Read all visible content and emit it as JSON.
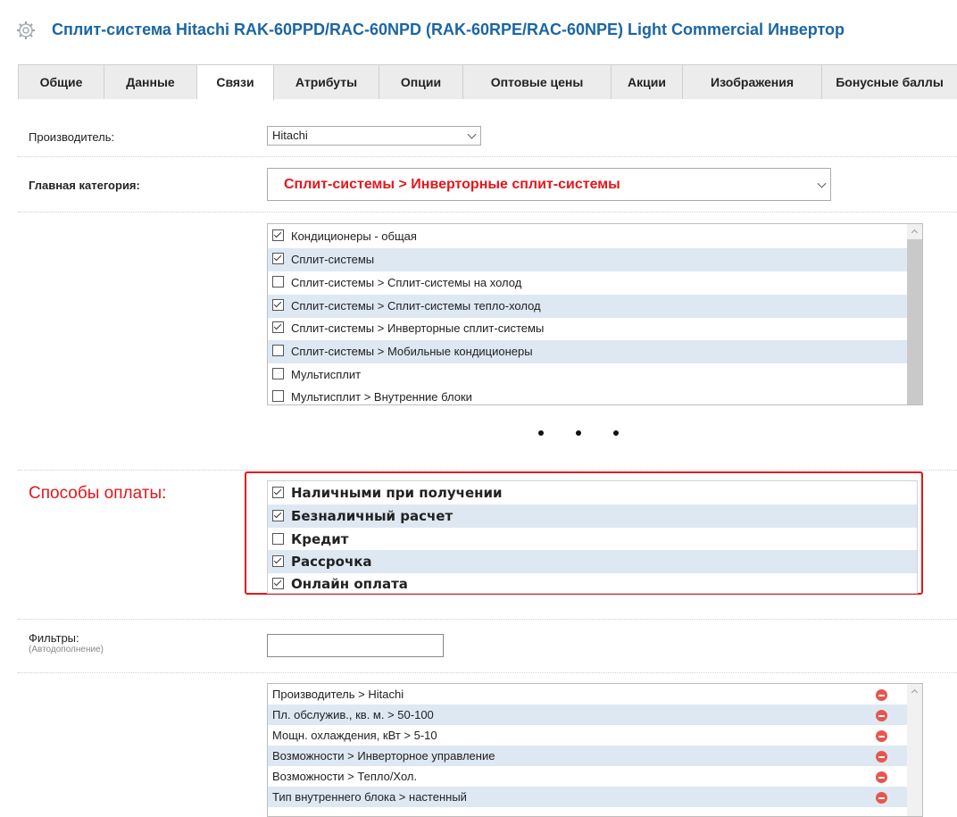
{
  "header": {
    "title": "Сплит-система Hitachi RAK-60PPD/RAC-60NPD (RAK-60RPE/RAC-60NPE) Light Commercial Инвертор",
    "icon": "gear-icon"
  },
  "tabs": [
    {
      "label": "Общие",
      "active": false
    },
    {
      "label": "Данные",
      "active": false
    },
    {
      "label": "Связи",
      "active": true
    },
    {
      "label": "Атрибуты",
      "active": false
    },
    {
      "label": "Опции",
      "active": false
    },
    {
      "label": "Оптовые цены",
      "active": false
    },
    {
      "label": "Акции",
      "active": false
    },
    {
      "label": "Изображения",
      "active": false
    },
    {
      "label": "Бонусные баллы",
      "active": false
    }
  ],
  "manufacturer": {
    "label": "Производитель:",
    "value": "Hitachi"
  },
  "main_category": {
    "label": "Главная категория:",
    "value": "Сплит-системы > Инверторные сплит-системы",
    "value_color": "#e5161b"
  },
  "categories": [
    {
      "label": "Кондиционеры - общая",
      "checked": true
    },
    {
      "label": "Сплит-системы",
      "checked": true
    },
    {
      "label": "Сплит-системы > Сплит-системы на холод",
      "checked": false
    },
    {
      "label": "Сплит-системы > Сплит-системы тепло-холод",
      "checked": true
    },
    {
      "label": "Сплит-системы > Инверторные сплит-системы",
      "checked": true
    },
    {
      "label": "Сплит-системы > Мобильные кондиционеры",
      "checked": false
    },
    {
      "label": "Мультисплит",
      "checked": false
    },
    {
      "label": "Мультисплит > Внутренние блоки",
      "checked": false
    }
  ],
  "payment": {
    "label": "Способы оплаты:",
    "accent_color": "#e5161b",
    "options": [
      {
        "label": "Наличными при получении",
        "checked": true
      },
      {
        "label": "Безналичный расчет",
        "checked": true
      },
      {
        "label": "Кредит",
        "checked": false
      },
      {
        "label": "Рассрочка",
        "checked": true
      },
      {
        "label": "Онлайн оплата",
        "checked": true
      }
    ]
  },
  "filters": {
    "label": "Фильтры:",
    "hint": "(Автодополнение)",
    "input_value": "",
    "items": [
      "Производитель > Hitachi",
      "Пл. обслужив., кв. м. > 50-100",
      "Мощн. охлаждения, кВт > 5-10",
      "Возможности > Инверторное управление",
      "Возможности > Тепло/Хол.",
      "Тип внутреннего блока > настенный"
    ]
  }
}
